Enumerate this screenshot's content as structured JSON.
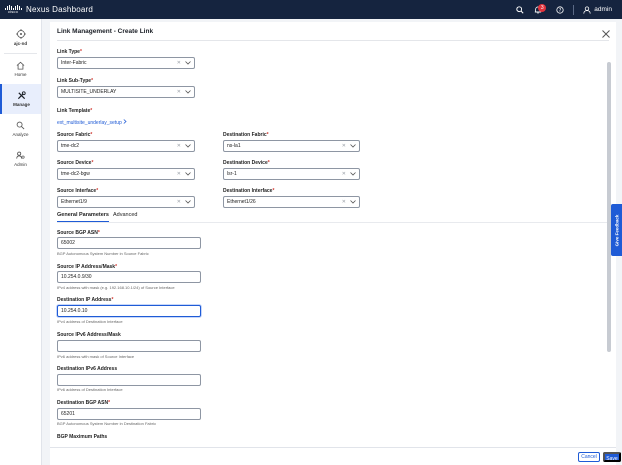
{
  "topbar": {
    "logo_text": "cisco",
    "app_title": "Nexus Dashboard",
    "notification_count": "3",
    "user_name": "admin"
  },
  "sidebar": {
    "scope": "ajc-nd",
    "items": [
      {
        "label": "Home",
        "icon": "home-icon",
        "active": false
      },
      {
        "label": "Manage",
        "icon": "tools-icon",
        "active": true
      },
      {
        "label": "Analyze",
        "icon": "analyze-icon",
        "active": false
      },
      {
        "label": "Admin",
        "icon": "admin-icon",
        "active": false
      }
    ]
  },
  "panel": {
    "title": "Link Management - Create Link",
    "link_type": {
      "label": "Link Type",
      "value": "Inter-Fabric"
    },
    "link_subtype": {
      "label": "Link Sub-Type",
      "value": "MULTISITE_UNDERLAY"
    },
    "link_template": {
      "label": "Link Template",
      "value": "ext_multisite_underlay_setup"
    },
    "source_fabric": {
      "label": "Source Fabric",
      "value": "tme-dc2"
    },
    "destination_fabric": {
      "label": "Destination Fabric",
      "value": "ns-la1"
    },
    "source_device": {
      "label": "Source Device",
      "value": "tme-dc2-bgw"
    },
    "destination_device": {
      "label": "Destination Device",
      "value": "lsr-1"
    },
    "source_interface": {
      "label": "Source Interface",
      "value": "Ethernet1/9"
    },
    "destination_interface": {
      "label": "Destination Interface",
      "value": "Ethernet1/26"
    },
    "tabs": [
      {
        "label": "General Parameters",
        "active": true
      },
      {
        "label": "Advanced",
        "active": false
      }
    ],
    "source_bgp_asn": {
      "label": "Source BGP ASN",
      "value": "65002",
      "help": "BGP Autonomous System Number in Source Fabric"
    },
    "source_ip": {
      "label": "Source IP Address/Mask",
      "value": "10.254.0.9/30",
      "help": "IPv4 address with mask (e.g. 192.168.10.1/24) of Source Interface"
    },
    "destination_ip": {
      "label": "Destination IP Address",
      "value": "10.254.0.10",
      "help": "IPv4 address of Destination Interface"
    },
    "source_ipv6": {
      "label": "Source IPv6 Address/Mask",
      "value": "",
      "help": "IPv6 address with mask of Source Interface"
    },
    "destination_ipv6": {
      "label": "Destination IPv6 Address",
      "value": "",
      "help": "IPv6 address of Destination Interface"
    },
    "destination_bgp_asn": {
      "label": "Destination BGP ASN",
      "value": "65201",
      "help": "BGP Autonomous System Number in Destination Fabric"
    },
    "bgp_max_paths": {
      "label": "BGP Maximum Paths"
    }
  },
  "feedback": {
    "label": "Give Feedback"
  },
  "footer": {
    "cancel_label": "Cancel",
    "save_label": "Save"
  },
  "colors": {
    "accent": "#1f5bd6",
    "topbar": "#15243f",
    "badge": "#e0333c",
    "required": "#d0342c"
  }
}
